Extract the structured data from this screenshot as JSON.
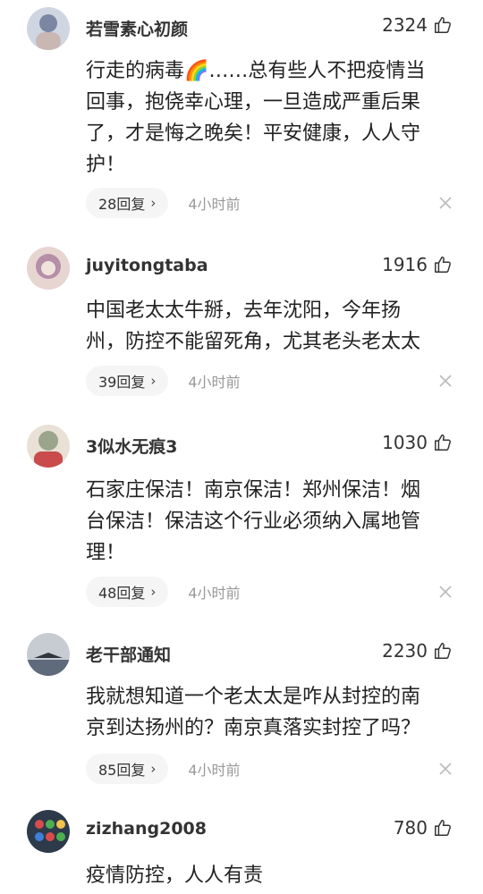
{
  "comments": [
    {
      "username": "若雪素心初颜",
      "likes": "2324",
      "text_lines": [
        "行走的病毒🌈……总有些人不把疫情当",
        "回事，抱侥幸心理，一旦造成严重后果",
        "了，才是悔之晚矣！平安健康，人人守",
        "护！"
      ],
      "reply_label": "28回复",
      "time": "4小时前",
      "avatar_colors": [
        "#7b86a3",
        "#c9b7b4"
      ]
    },
    {
      "username": "juyitongtaba",
      "likes": "1916",
      "text_lines": [
        "中国老太太牛掰，去年沈阳，今年扬",
        "州，防控不能留死角，尤其老头老太太"
      ],
      "reply_label": "39回复",
      "time": "4小时前",
      "avatar_colors": [
        "#b58ea8",
        "#e7d5d2"
      ]
    },
    {
      "username": "3似水无痕3",
      "likes": "1030",
      "text_lines": [
        "石家庄保洁！南京保洁！郑州保洁！烟",
        "台保洁！保洁这个行业必须纳入属地管",
        "理！"
      ],
      "reply_label": "48回复",
      "time": "4小时前",
      "avatar_colors": [
        "#9aa58b",
        "#e9e1d6"
      ]
    },
    {
      "username": "老干部通知",
      "likes": "2230",
      "text_lines": [
        "我就想知道一个老太太是咋从封控的南",
        "京到达扬州的？南京真落实封控了吗？"
      ],
      "reply_label": "85回复",
      "time": "4小时前",
      "avatar_colors": [
        "#5f6b7a",
        "#c7ccd2"
      ]
    },
    {
      "username": "zizhang2008",
      "likes": "780",
      "text_lines": [
        "疫情防控，人人有责"
      ],
      "reply_label": "",
      "time": "",
      "avatar_colors": [
        "#2d3a4a",
        "#d94c4c"
      ]
    }
  ],
  "icons": {
    "like": "thumbs-up-icon",
    "close": "close-icon",
    "chevron": "chevron-right-icon"
  },
  "chevron_glyph": "›"
}
